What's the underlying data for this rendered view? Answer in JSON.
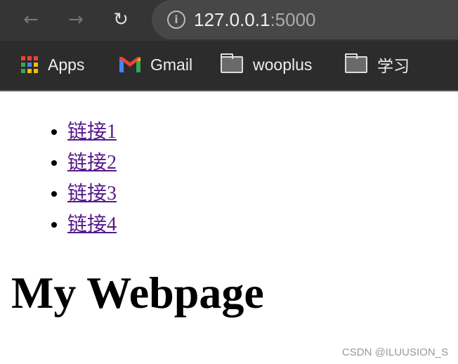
{
  "browser": {
    "url_host": "127.0.0.1",
    "url_port": ":5000",
    "bookmarks": [
      {
        "label": "Apps",
        "icon": "apps-grid-icon"
      },
      {
        "label": "Gmail",
        "icon": "gmail-icon"
      },
      {
        "label": "wooplus",
        "icon": "folder-icon"
      },
      {
        "label": "学习",
        "icon": "folder-icon"
      }
    ]
  },
  "page": {
    "links": [
      "链接1",
      "链接2",
      "链接3",
      "链接4"
    ],
    "heading": "My Webpage"
  },
  "watermark": "CSDN @ILUUSION_S",
  "colors": {
    "link": "#551a8b",
    "toolbar": "#353535"
  }
}
